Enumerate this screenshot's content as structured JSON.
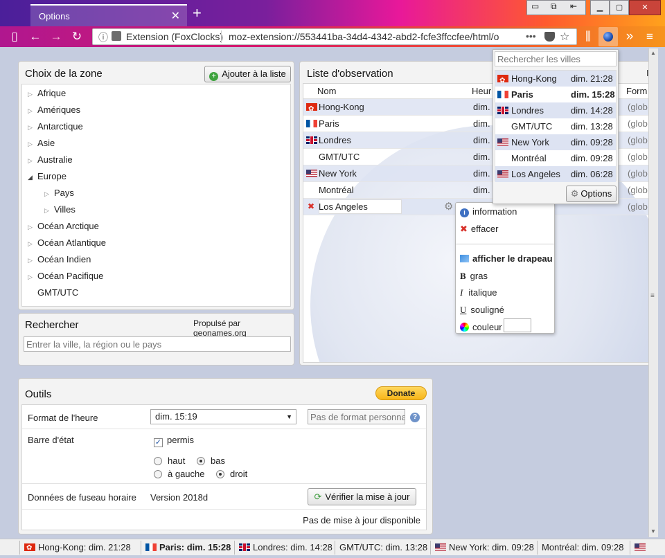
{
  "browser": {
    "tab_title": "Options",
    "tab_close": "✕",
    "new_tab": "+",
    "identity_label": "Extension (FoxClocks)",
    "url": "moz-extension://553441ba-34d4-4342-abd2-fcfe3ffccfee/html/o",
    "more": "•••"
  },
  "zone_panel": {
    "title": "Choix de la zone",
    "add_button": "Ajouter à la liste",
    "items": [
      {
        "label": "Afrique"
      },
      {
        "label": "Amériques"
      },
      {
        "label": "Antarctique"
      },
      {
        "label": "Asie"
      },
      {
        "label": "Australie"
      },
      {
        "label": "Europe"
      },
      {
        "label": "Pays"
      },
      {
        "label": "Villes"
      },
      {
        "label": "Océan Arctique"
      },
      {
        "label": "Océan Atlantique"
      },
      {
        "label": "Océan Indien"
      },
      {
        "label": "Océan Pacifique"
      },
      {
        "label": "GMT/UTC"
      }
    ]
  },
  "search_panel": {
    "title": "Rechercher",
    "powered_by": "Propulsé par geonames.org",
    "placeholder": "Entrer la ville, la région ou le pays"
  },
  "watch_panel": {
    "title": "Liste d'observation",
    "col_name": "Nom",
    "col_time": "Heur",
    "col_format": "Form",
    "right_letter": "I",
    "rows": [
      {
        "name": "Hong-Kong",
        "time": "dim.",
        "format": "(glob"
      },
      {
        "name": "Paris",
        "time": "dim.",
        "format": "(glob"
      },
      {
        "name": "Londres",
        "time": "dim.",
        "format": "(glob"
      },
      {
        "name": "GMT/UTC",
        "time": "dim.",
        "format": "(glob"
      },
      {
        "name": "New York",
        "time": "dim. (",
        "format": "(glob"
      },
      {
        "name": "Montréal",
        "time": "dim. (",
        "format": "(glob"
      },
      {
        "name": "Los Angeles",
        "time": "",
        "format": "(glob"
      }
    ]
  },
  "context_menu": {
    "info": "information",
    "delete": "effacer",
    "show_flag": "afficher le drapeau",
    "bold": "gras",
    "italic": "italique",
    "underline": "souligné",
    "color": "couleur",
    "bold_glyph": "B",
    "italic_glyph": "I",
    "underline_glyph": "U"
  },
  "clock_popup": {
    "search_placeholder": "Rechercher les villes",
    "rows": [
      {
        "city": "Hong-Kong",
        "time": "dim. 21:28"
      },
      {
        "city": "Paris",
        "time": "dim. 15:28"
      },
      {
        "city": "Londres",
        "time": "dim. 14:28"
      },
      {
        "city": "GMT/UTC",
        "time": "dim. 13:28"
      },
      {
        "city": "New York",
        "time": "dim. 09:28"
      },
      {
        "city": "Montréal",
        "time": "dim. 09:28"
      },
      {
        "city": "Los Angeles",
        "time": "dim. 06:28"
      }
    ],
    "options_button": "Options"
  },
  "tools": {
    "title": "Outils",
    "donate": "Donate",
    "time_format_label": "Format de l'heure",
    "time_format_value": "dim. 15:19",
    "custom_format_placeholder": "Pas de format personna",
    "statusbar_label": "Barre d'état",
    "allowed": "permis",
    "top": "haut",
    "bottom": "bas",
    "left": "à gauche",
    "right": "droit",
    "tz_label": "Données de fuseau horaire",
    "tz_version": "Version 2018d",
    "check_update": "Vérifier la mise à jour",
    "no_update": "Pas de mise à jour disponible"
  },
  "statusbar": [
    {
      "text": "Hong-Kong: dim. 21:28"
    },
    {
      "text": "Paris: dim. 15:28"
    },
    {
      "text": "Londres: dim. 14:28"
    },
    {
      "text": "GMT/UTC: dim. 13:28"
    },
    {
      "text": "New York: dim. 09:28"
    },
    {
      "text": "Montréal: dim. 09:28"
    }
  ],
  "colors": {
    "accent": "#f7c32b",
    "selection": "#dde3f2"
  }
}
